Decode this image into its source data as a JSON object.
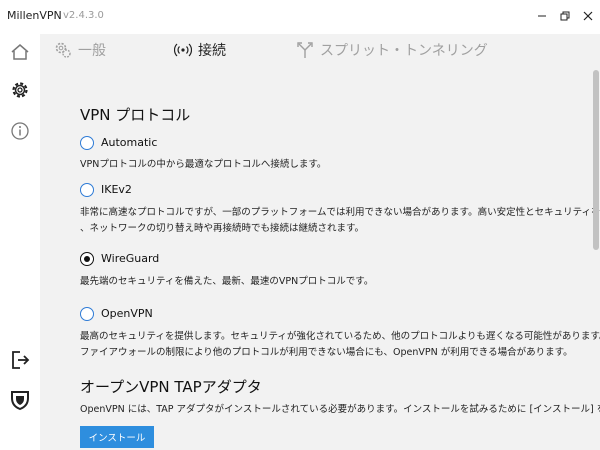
{
  "window": {
    "app_name": "MillenVPN",
    "version": "v2.4.3.0"
  },
  "tabs": [
    {
      "label": "一般",
      "icon": "gear-cluster-icon",
      "active": false
    },
    {
      "label": "接続",
      "icon": "broadcast-icon",
      "active": true
    },
    {
      "label": "スプリット・トンネリング",
      "icon": "fork-icon",
      "active": false
    }
  ],
  "sidebar": {
    "items": [
      {
        "icon": "home-icon"
      },
      {
        "icon": "gear-icon"
      },
      {
        "icon": "info-icon"
      },
      {
        "icon": "logout-icon"
      },
      {
        "icon": "shield-icon"
      }
    ]
  },
  "vpn_protocol": {
    "title": "VPN プロトコル",
    "options": [
      {
        "label": "Automatic",
        "description": "VPNプロトコルの中から最適なプロトコルへ接続します。",
        "selected": false
      },
      {
        "label": "IKEv2",
        "description_line1": "非常に高速なプロトコルですが、一部のプラットフォームでは利用できない場合があります。高い安定性とセキュリティを提供し",
        "description_line2": "、ネットワークの切り替え時や再接続時でも接続は継続されます。",
        "selected": false
      },
      {
        "label": "WireGuard",
        "description": "最先端のセキュリティを備えた、最新、最速のVPNプロトコルです。",
        "selected": true
      },
      {
        "label": "OpenVPN",
        "description_line1": "最高のセキュリティを提供します。セキュリティが強化されているため、他のプロトコルよりも遅くなる可能性があります。また、",
        "description_line2": "ファイアウォールの制限により他のプロトコルが利用できない場合にも、OpenVPN が利用できる場合があります。",
        "selected": false
      }
    ]
  },
  "tap_adapter": {
    "title": "オープンVPN TAPアダプタ",
    "description": "OpenVPN には、TAP アダプタがインストールされている必要があります。インストールを試みるために [インストール] をクリックし",
    "install_label": "インストール"
  },
  "colors": {
    "accent": "#2e8ede",
    "radio_border": "#2e7bd6",
    "content_bg": "#f2f2f2"
  }
}
